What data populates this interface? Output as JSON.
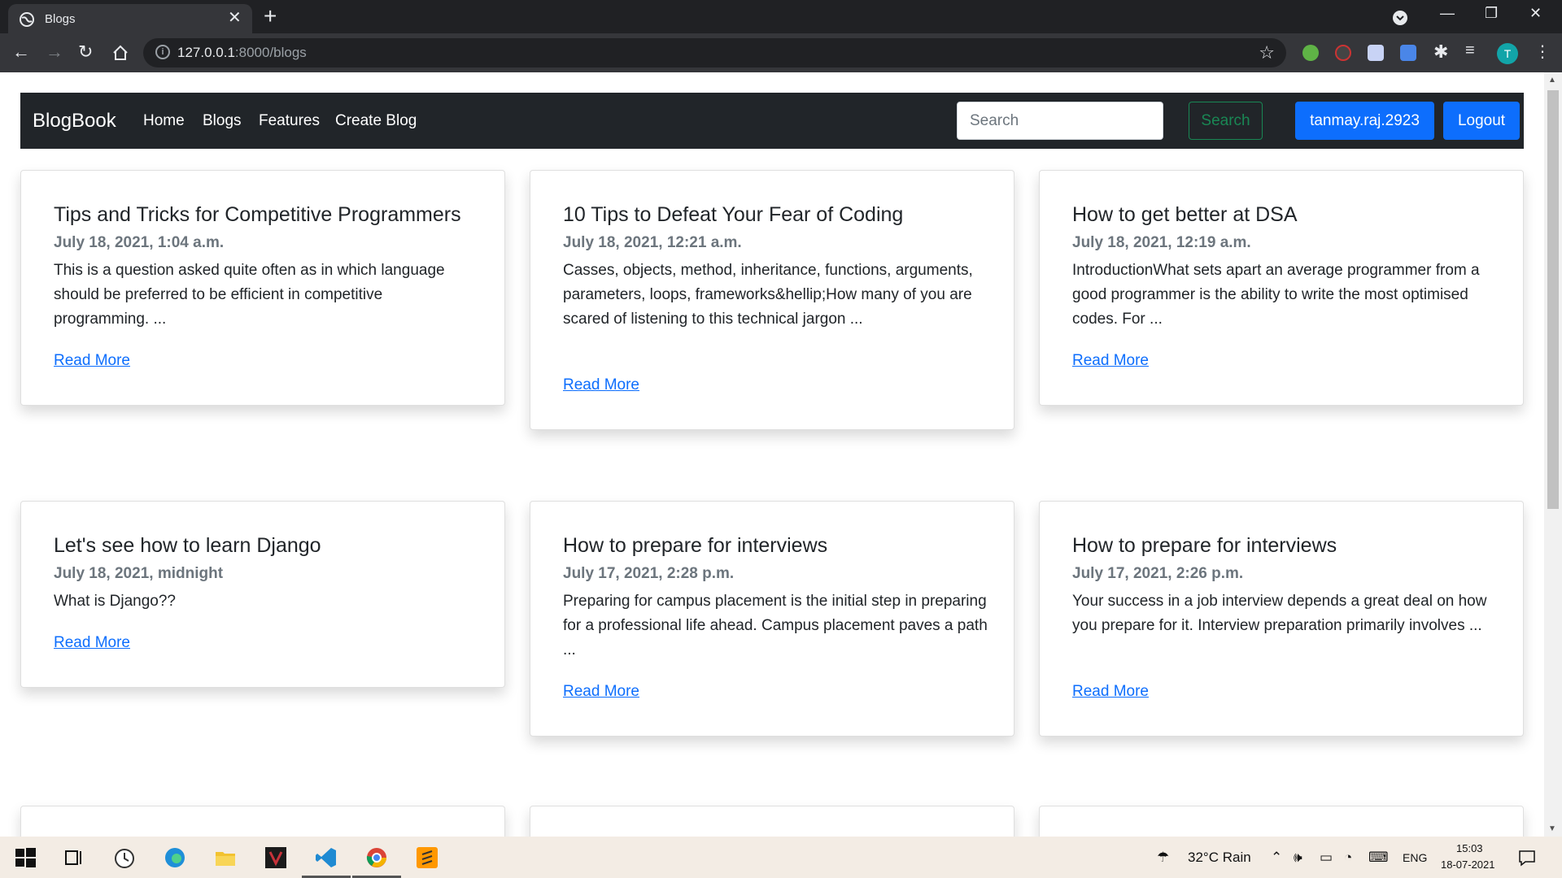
{
  "browser": {
    "tab_title": "Blogs",
    "url_host": "127.0.0.1",
    "url_rest": ":8000/blogs",
    "profile_initial": "T"
  },
  "navbar": {
    "brand": "BlogBook",
    "links": [
      "Home",
      "Blogs",
      "Features",
      "Create Blog"
    ],
    "search_placeholder": "Search",
    "search_button": "Search",
    "username": "tanmay.raj.2923",
    "logout": "Logout"
  },
  "cards": [
    {
      "title": "Tips and Tricks for Competitive Programmers",
      "date": "July 18, 2021, 1:04 a.m.",
      "body": "This is a question asked quite often as in which language should be preferred to be efficient in competitive programming. ...",
      "link": "Read More"
    },
    {
      "title": "10 Tips to Defeat Your Fear of Coding",
      "date": "July 18, 2021, 12:21 a.m.",
      "body": "Casses, objects, method, inheritance, functions, arguments, parameters, loops, frameworks&hellip;How many of you are scared of listening to this technical jargon ...",
      "link": "Read More"
    },
    {
      "title": "How to get better at DSA",
      "date": "July 18, 2021, 12:19 a.m.",
      "body": "IntroductionWhat sets apart an average programmer from a good programmer is the ability to write the most optimised codes. For ...",
      "link": "Read More"
    },
    {
      "title": "Let's see how to learn Django",
      "date": "July 18, 2021, midnight",
      "body": "What is Django??",
      "link": "Read More"
    },
    {
      "title": "How to prepare for interviews",
      "date": "July 17, 2021, 2:28 p.m.",
      "body": "Preparing for campus placement is the initial step in preparing for a professional life ahead. Campus placement paves a path ...",
      "link": "Read More"
    },
    {
      "title": "How to prepare for interviews",
      "date": "July 17, 2021, 2:26 p.m.",
      "body": "Your success in a job interview depends a great deal on how you prepare for it. Interview preparation primarily involves ...",
      "link": "Read More"
    }
  ],
  "taskbar": {
    "weather": "32°C  Rain",
    "language": "ENG",
    "time": "15:03",
    "date": "18-07-2021"
  },
  "colors": {
    "navbar_bg": "#212529",
    "primary": "#0d6efd",
    "success": "#198754",
    "muted": "#6c757d"
  }
}
